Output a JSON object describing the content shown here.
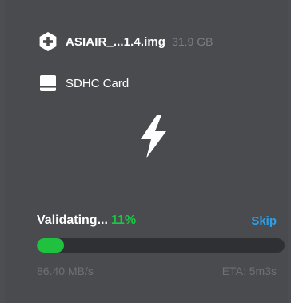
{
  "image": {
    "name": "ASIAIR_...1.4.img",
    "size": "31.9 GB",
    "icon": "plus-circle-icon"
  },
  "drive": {
    "name": "SDHC Card",
    "icon": "drive-icon"
  },
  "flash": {
    "icon": "lightning-icon"
  },
  "progress": {
    "status": "Validating...",
    "percent_label": "11%",
    "fraction": 0.11,
    "skip_label": "Skip",
    "speed": "86.40 MB/s",
    "eta": "ETA: 5m3s"
  },
  "colors": {
    "background": "#4a4b4f",
    "progress_fill": "#1fc13e",
    "progress_track": "#2f3033",
    "percent_text": "#18c943",
    "skip_link": "#2f9ee6",
    "muted_text": "#6f7075"
  }
}
